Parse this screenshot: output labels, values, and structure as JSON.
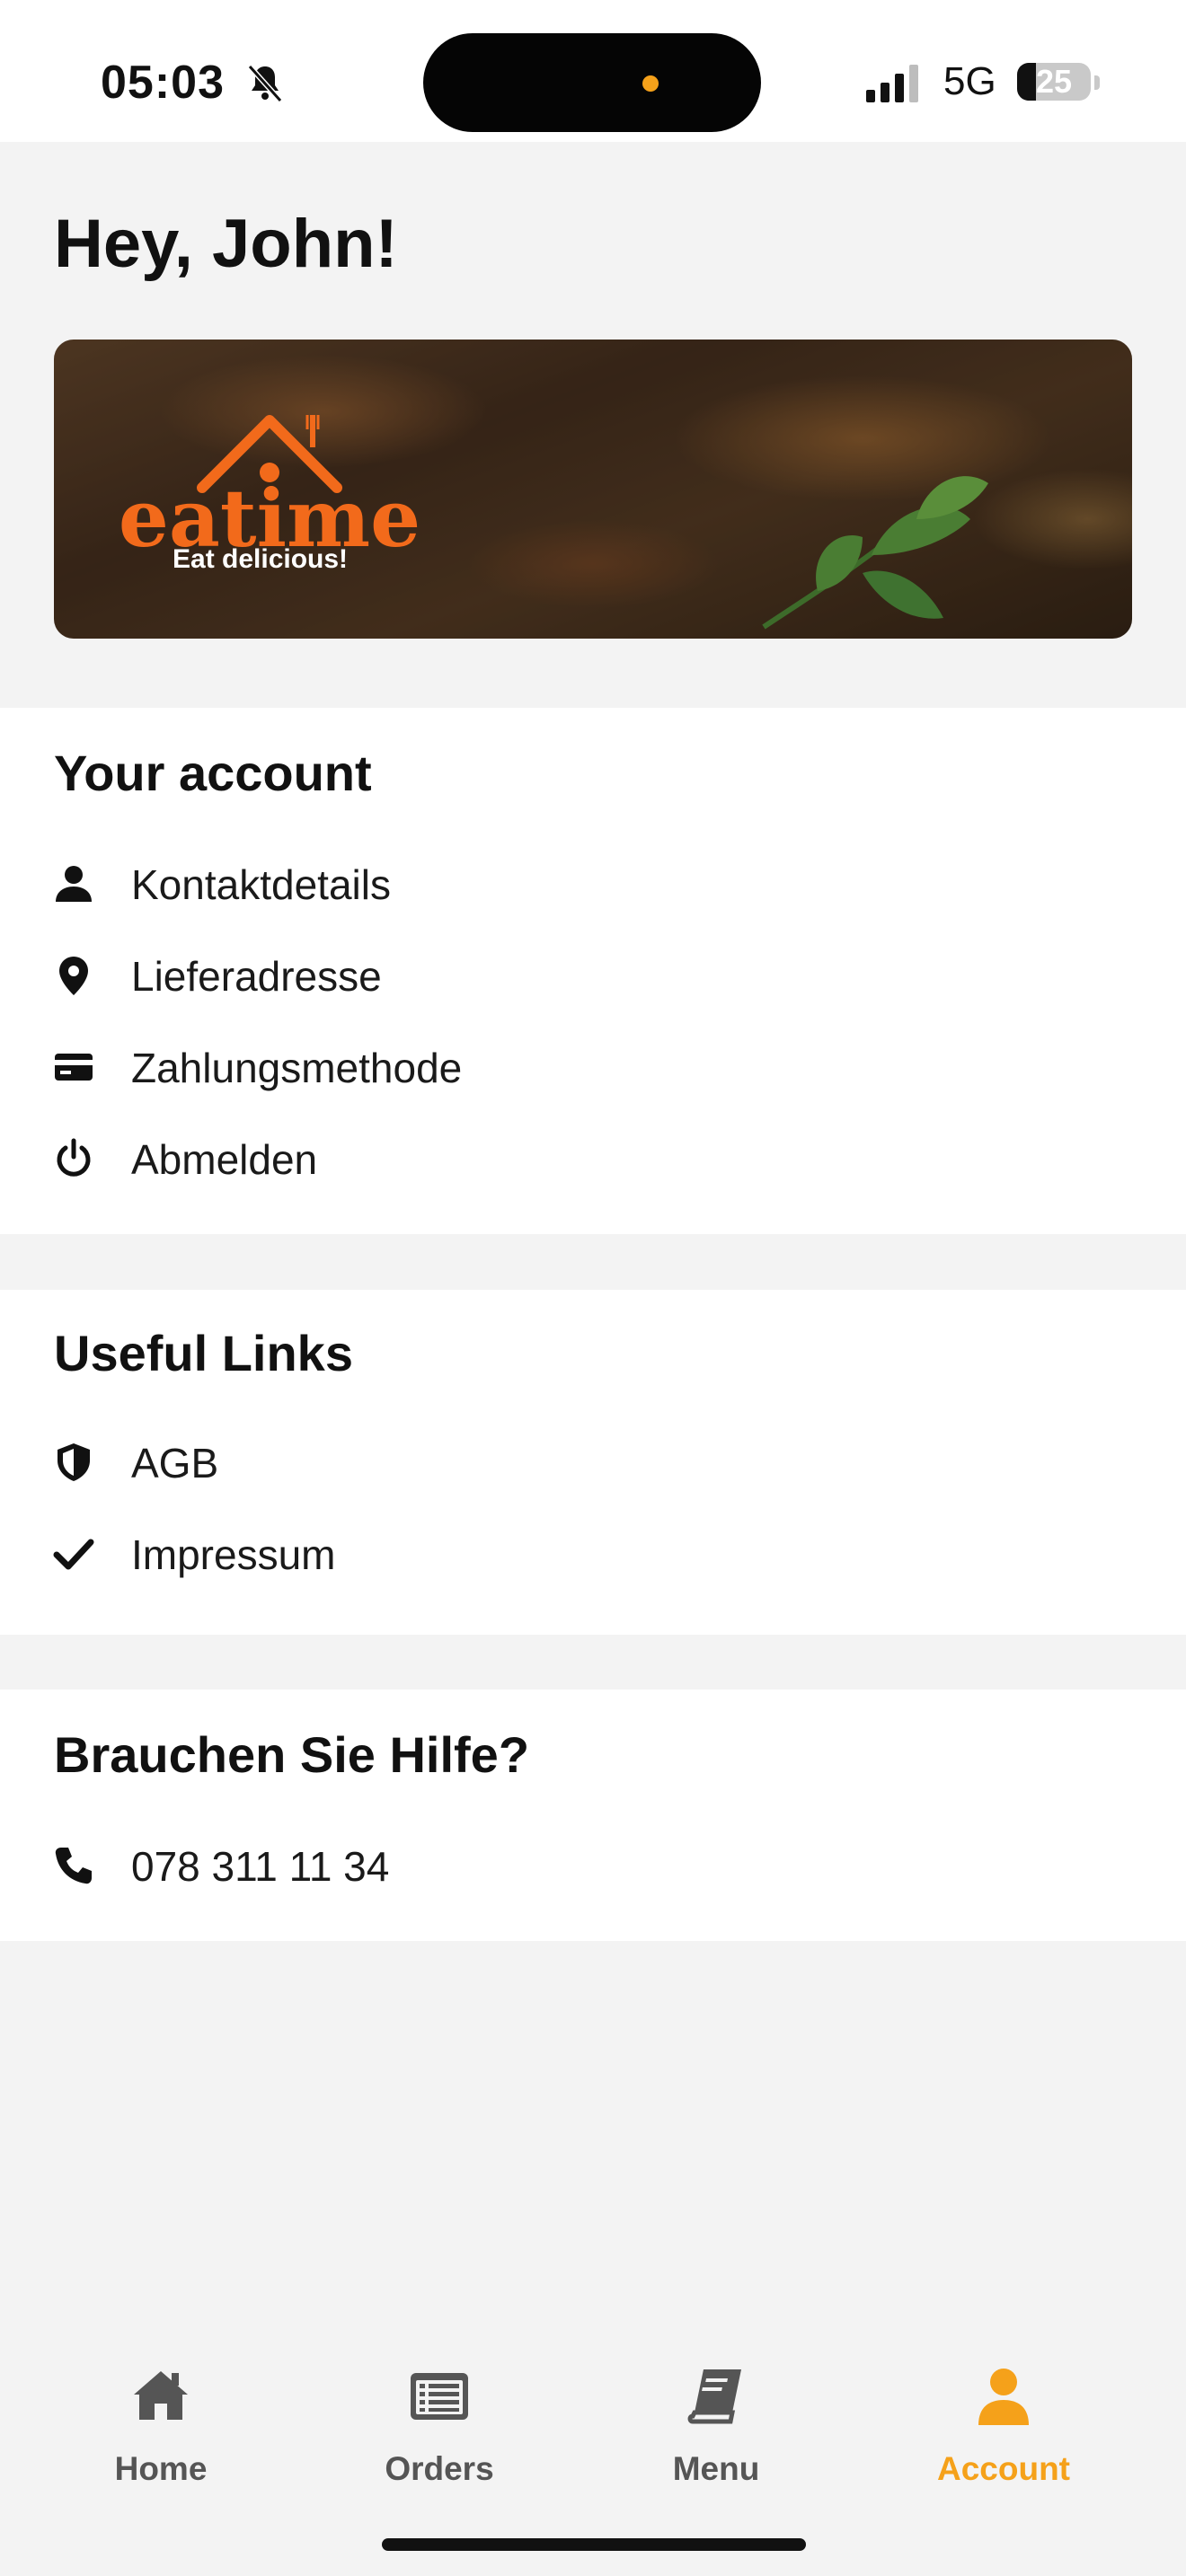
{
  "status_bar": {
    "time": "05:03",
    "network": "5G",
    "battery_level": "25",
    "battery_fraction": 0.25
  },
  "greeting": "Hey, John!",
  "banner": {
    "brand_name": "eatime",
    "tagline": "Eat delicious!",
    "brand_color": "#f26a1b"
  },
  "account_section": {
    "title": "Your account",
    "items": [
      {
        "label": "Kontaktdetails",
        "icon": "person-icon"
      },
      {
        "label": "Lieferadresse",
        "icon": "location-pin-icon"
      },
      {
        "label": "Zahlungsmethode",
        "icon": "credit-card-icon"
      },
      {
        "label": "Abmelden",
        "icon": "power-icon"
      }
    ]
  },
  "links_section": {
    "title": "Useful Links",
    "items": [
      {
        "label": "AGB",
        "icon": "shield-icon"
      },
      {
        "label": "Impressum",
        "icon": "checkmark-icon"
      }
    ]
  },
  "help_section": {
    "title": "Brauchen Sie Hilfe?",
    "phone": "078 311 11 34",
    "icon": "phone-icon"
  },
  "bottom_nav": {
    "items": [
      {
        "label": "Home",
        "icon": "home-icon",
        "active": false
      },
      {
        "label": "Orders",
        "icon": "orders-list-icon",
        "active": false
      },
      {
        "label": "Menu",
        "icon": "menu-book-icon",
        "active": false
      },
      {
        "label": "Account",
        "icon": "account-icon",
        "active": true
      }
    ]
  },
  "colors": {
    "accent": "#f5a11a",
    "background": "#f3f3f3",
    "card": "#ffffff",
    "text": "#111111",
    "nav_inactive": "#555555"
  }
}
